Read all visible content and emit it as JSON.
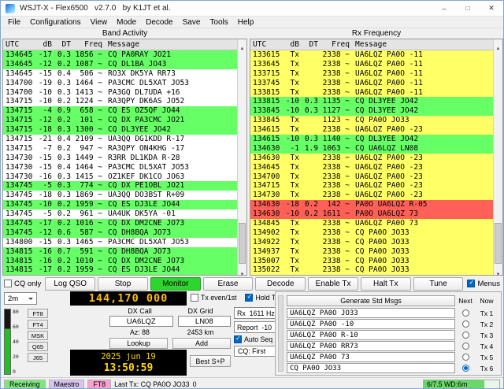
{
  "window": {
    "title": "WSJT-X - Flex6500   v2.7.0   by K1JT et al."
  },
  "menu": {
    "items": [
      "File",
      "Configurations",
      "View",
      "Mode",
      "Decode",
      "Save",
      "Tools",
      "Help"
    ]
  },
  "band_activity": {
    "title": "Band Activity",
    "headers": {
      "utc": "UTC",
      "db": "dB",
      "dt": "DT",
      "freq": "Freq",
      "msg": "Message"
    },
    "rows": [
      {
        "utc": "134645",
        "db": "-17",
        "dt": "0.3",
        "freq": "1856 ~",
        "msg": "CQ PA0RAY JO21",
        "color": "g"
      },
      {
        "utc": "134645",
        "db": "-12",
        "dt": "0.2",
        "freq": "1087 ~",
        "msg": "CQ DL1BA JO43",
        "color": "g"
      },
      {
        "utc": "134645",
        "db": "-15",
        "dt": "0.4",
        "freq": "506 ~",
        "msg": "RO3X DK5YA RR73",
        "color": "w"
      },
      {
        "utc": "134700",
        "db": "-19",
        "dt": "0.3",
        "freq": "1464 ~",
        "msg": "PA3CMC DL5XAT JO53",
        "color": "w"
      },
      {
        "utc": "134700",
        "db": "-10",
        "dt": "0.3",
        "freq": "1413 ~",
        "msg": "PA3GQ DL7UDA +16",
        "color": "w"
      },
      {
        "utc": "134715",
        "db": "-10",
        "dt": "0.2",
        "freq": "1224 ~",
        "msg": "RA3QPY DK6AS JO52",
        "color": "w"
      },
      {
        "utc": "134715",
        "db": "-4",
        "dt": "0.9",
        "freq": "658 ~",
        "msg": "CQ ES OZ5QF JO44",
        "color": "g"
      },
      {
        "utc": "134715",
        "db": "-12",
        "dt": "0.2",
        "freq": "101 ~",
        "msg": "CQ DX PA3CMC JO21",
        "color": "g"
      },
      {
        "utc": "134715",
        "db": "-18",
        "dt": "0.3",
        "freq": "1300 ~",
        "msg": "CQ DL3YEE JO42",
        "color": "g"
      },
      {
        "utc": "134715",
        "db": "-21",
        "dt": "0.4",
        "freq": "2109 ~",
        "msg": "UA3QQ DG1KDD R-17",
        "color": "w"
      },
      {
        "utc": "134715",
        "db": "-7",
        "dt": "0.2",
        "freq": "947 ~",
        "msg": "RA3QPY ON4KHG -17",
        "color": "w"
      },
      {
        "utc": "134730",
        "db": "-15",
        "dt": "0.3",
        "freq": "1449 ~",
        "msg": "R3RR DL1KDA R-28",
        "color": "w"
      },
      {
        "utc": "134730",
        "db": "-15",
        "dt": "0.4",
        "freq": "1464 ~",
        "msg": "PA3CMC DL5XAT JO53",
        "color": "w"
      },
      {
        "utc": "134730",
        "db": "-16",
        "dt": "0.3",
        "freq": "1415 ~",
        "msg": "OZ1KEF DK1CO JO63",
        "color": "w"
      },
      {
        "utc": "134745",
        "db": "-5",
        "dt": "0.3",
        "freq": "774 ~",
        "msg": "CQ DX PE1OBL JO21",
        "color": "g"
      },
      {
        "utc": "134745",
        "db": "-18",
        "dt": "0.3",
        "freq": "1869 ~",
        "msg": "UA3QQ DO3BST R+09",
        "color": "w"
      },
      {
        "utc": "134745",
        "db": "-10",
        "dt": "0.2",
        "freq": "1959 ~",
        "msg": "CQ ES DJ3LE JO44",
        "color": "g"
      },
      {
        "utc": "134745",
        "db": "-5",
        "dt": "0.2",
        "freq": "961 ~",
        "msg": "UA4UK DK5YA -01",
        "color": "w"
      },
      {
        "utc": "134745",
        "db": "-17",
        "dt": "0.2",
        "freq": "1016 ~",
        "msg": "CQ DX DM2CNE JO73",
        "color": "g"
      },
      {
        "utc": "134745",
        "db": "-12",
        "dt": "0.6",
        "freq": "587 ~",
        "msg": "CQ DH8BQA JO73",
        "color": "g"
      },
      {
        "utc": "134800",
        "db": "-15",
        "dt": "0.3",
        "freq": "1465 ~",
        "msg": "PA3CMC DL5XAT JO53",
        "color": "w"
      },
      {
        "utc": "134815",
        "db": "-16",
        "dt": "0.7",
        "freq": "591 ~",
        "msg": "CQ DH8BQA JO73",
        "color": "g"
      },
      {
        "utc": "134815",
        "db": "-16",
        "dt": "0.2",
        "freq": "1010 ~",
        "msg": "CQ DX DM2CNE JO73",
        "color": "g"
      },
      {
        "utc": "134815",
        "db": "-17",
        "dt": "0.2",
        "freq": "1959 ~",
        "msg": "CQ ES DJ3LE JO44",
        "color": "g"
      }
    ]
  },
  "rx_frequency": {
    "title": "Rx Frequency",
    "headers": {
      "utc": "UTC",
      "db": "dB",
      "dt": "DT",
      "freq": "Freq",
      "msg": "Message"
    },
    "rows": [
      {
        "utc": "133615",
        "db": "Tx",
        "dt": "",
        "freq": "2338 ~",
        "msg": "UA6LQZ PA0O -11",
        "color": "y"
      },
      {
        "utc": "133645",
        "db": "Tx",
        "dt": "",
        "freq": "2338 ~",
        "msg": "UA6LQZ PA0O -11",
        "color": "y"
      },
      {
        "utc": "133715",
        "db": "Tx",
        "dt": "",
        "freq": "2338 ~",
        "msg": "UA6LQZ PA0O -11",
        "color": "y"
      },
      {
        "utc": "133745",
        "db": "Tx",
        "dt": "",
        "freq": "2338 ~",
        "msg": "UA6LQZ PA0O -11",
        "color": "y"
      },
      {
        "utc": "133815",
        "db": "Tx",
        "dt": "",
        "freq": "2338 ~",
        "msg": "UA6LQZ PA0O -11",
        "color": "y"
      },
      {
        "utc": "133815",
        "db": "-10",
        "dt": "0.3",
        "freq": "1135 ~",
        "msg": "CQ DL3YEE JO42",
        "color": "g"
      },
      {
        "utc": "133845",
        "db": "-10",
        "dt": "0.3",
        "freq": "1127 ~",
        "msg": "CQ DL3YEE JO42",
        "color": "g"
      },
      {
        "utc": "133845",
        "db": "Tx",
        "dt": "",
        "freq": "1123 ~",
        "msg": "CQ PA0O JO33",
        "color": "y"
      },
      {
        "utc": "134615",
        "db": "Tx",
        "dt": "",
        "freq": "2338 ~",
        "msg": "UA6LQZ PA0O -23",
        "color": "y"
      },
      {
        "utc": "134615",
        "db": "-10",
        "dt": "0.3",
        "freq": "1140 ~",
        "msg": "CQ DL3YEE JO42",
        "color": "g"
      },
      {
        "utc": "134630",
        "db": "-1",
        "dt": "1.9",
        "freq": "1063 ~",
        "msg": "CQ UA6LQZ LN08",
        "color": "g"
      },
      {
        "utc": "134630",
        "db": "Tx",
        "dt": "",
        "freq": "2338 ~",
        "msg": "UA6LQZ PA0O -23",
        "color": "y"
      },
      {
        "utc": "134645",
        "db": "Tx",
        "dt": "",
        "freq": "2338 ~",
        "msg": "UA6LQZ PA0O -23",
        "color": "y"
      },
      {
        "utc": "134700",
        "db": "Tx",
        "dt": "",
        "freq": "2338 ~",
        "msg": "UA6LQZ PA0O -23",
        "color": "y"
      },
      {
        "utc": "134715",
        "db": "Tx",
        "dt": "",
        "freq": "2338 ~",
        "msg": "UA6LQZ PA0O -23",
        "color": "y"
      },
      {
        "utc": "134730",
        "db": "Tx",
        "dt": "",
        "freq": "2338 ~",
        "msg": "UA6LQZ PA0O -23",
        "color": "y"
      },
      {
        "utc": "134630",
        "db": "-18",
        "dt": "0.2",
        "freq": "142 ~",
        "msg": "PA0O UA6LQZ R-05",
        "color": "r"
      },
      {
        "utc": "134630",
        "db": "-10",
        "dt": "0.2",
        "freq": "1611 ~",
        "msg": "PA0O UA6LQZ 73",
        "color": "r"
      },
      {
        "utc": "134845",
        "db": "Tx",
        "dt": "",
        "freq": "2338 ~",
        "msg": "UA6LQZ PA0O 73",
        "color": "y"
      },
      {
        "utc": "134902",
        "db": "Tx",
        "dt": "",
        "freq": "2338 ~",
        "msg": "CQ PA0O JO33",
        "color": "y"
      },
      {
        "utc": "134922",
        "db": "Tx",
        "dt": "",
        "freq": "2338 ~",
        "msg": "CQ PA0O JO33",
        "color": "y"
      },
      {
        "utc": "134937",
        "db": "Tx",
        "dt": "",
        "freq": "2338 ~",
        "msg": "CQ PA0O JO33",
        "color": "y"
      },
      {
        "utc": "135007",
        "db": "Tx",
        "dt": "",
        "freq": "2338 ~",
        "msg": "CQ PA0O JO33",
        "color": "y"
      },
      {
        "utc": "135022",
        "db": "Tx",
        "dt": "",
        "freq": "2338 ~",
        "msg": "CQ PA0O JO33",
        "color": "y"
      }
    ]
  },
  "action_bar": {
    "cq_only": "CQ only",
    "log_qso": "Log QSO",
    "stop": "Stop",
    "monitor": "Monitor",
    "erase": "Erase",
    "decode": "Decode",
    "enable_tx": "Enable Tx",
    "halt_tx": "Halt Tx",
    "tune": "Tune",
    "menus": "Menus"
  },
  "station": {
    "band": "2m",
    "frequency": "144,170 000",
    "meter_ticks": [
      "80",
      "60",
      "40",
      "20",
      "0"
    ],
    "mode_buttons": [
      "FT8",
      "FT4",
      "MSK",
      "Q65",
      "J65"
    ],
    "tx_even_label": "Tx even/1st",
    "hold_tx_label": "Hold Tx Freq",
    "dx_call_label": "DX Call",
    "dx_grid_label": "DX Grid",
    "dx_call": "UA6LQZ",
    "dx_grid": "LN08",
    "azimuth": "Az: 88",
    "distance": "2453 km",
    "lookup_label": "Lookup",
    "add_label": "Add",
    "rx_offset": "Rx  1611 Hz",
    "report": "Report  -10",
    "auto_seq_label": "Auto Seq",
    "cq_first_label": "CQ: First",
    "date": "2025 jun 19",
    "time": "13:50:59",
    "best_sp_label": "Best S+P"
  },
  "messages": {
    "generate_label": "Generate Std Msgs",
    "next_label": "Next",
    "now_label": "Now",
    "rows": [
      {
        "text": "UA6LQZ PA0O JO33",
        "tx": "Tx 1",
        "selected": false
      },
      {
        "text": "UA6LQZ PA0O -10",
        "tx": "Tx 2",
        "selected": false
      },
      {
        "text": "UA6LQZ PA0O R-10",
        "tx": "Tx 3",
        "selected": false
      },
      {
        "text": "UA6LQZ PA0O RR73",
        "tx": "Tx 4",
        "selected": false
      },
      {
        "text": "UA6LQZ PA0O 73",
        "tx": "Tx 5",
        "selected": false
      },
      {
        "text": "CQ PA0O JO33",
        "tx": "Tx 6",
        "selected": true
      }
    ]
  },
  "status": {
    "state": "Receiving",
    "device": "Maestro",
    "mode": "FT8",
    "last_tx": "Last Tx: CQ PA0O JO33",
    "counter": "0",
    "progress": "6/7.5 WD:6m"
  },
  "colors": {
    "cq_highlight": "#66ff66",
    "tx_highlight": "#ffff66",
    "mycall_highlight": "#ff6057",
    "monitor_active": "#2ed52e",
    "frequency_digits": "#ffbf00",
    "clock_digits": "#ffd700"
  }
}
